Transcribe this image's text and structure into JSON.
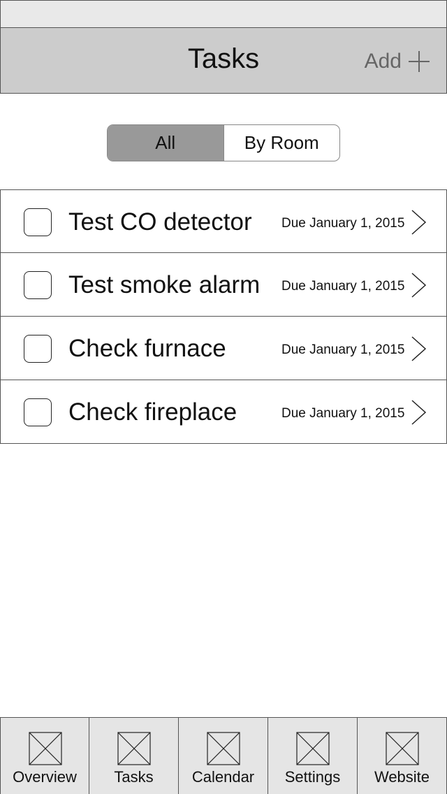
{
  "header": {
    "title": "Tasks",
    "add_label": "Add"
  },
  "filter": {
    "segments": [
      {
        "label": "All",
        "selected": true
      },
      {
        "label": "By Room",
        "selected": false
      }
    ]
  },
  "tasks": [
    {
      "title": "Test CO detector",
      "due": "Due January 1, 2015",
      "checked": false
    },
    {
      "title": "Test smoke alarm",
      "due": "Due January 1, 2015",
      "checked": false
    },
    {
      "title": "Check furnace",
      "due": "Due January 1, 2015",
      "checked": false
    },
    {
      "title": "Check fireplace",
      "due": "Due January 1, 2015",
      "checked": false
    }
  ],
  "tab_bar": {
    "tabs": [
      {
        "label": "Overview",
        "icon": "image-placeholder-icon"
      },
      {
        "label": "Tasks",
        "icon": "image-placeholder-icon"
      },
      {
        "label": "Calendar",
        "icon": "image-placeholder-icon"
      },
      {
        "label": "Settings",
        "icon": "image-placeholder-icon"
      },
      {
        "label": "Website",
        "icon": "image-placeholder-icon"
      }
    ]
  },
  "colors": {
    "nav_background": "#cccccc",
    "status_background": "#e9e9e9",
    "segment_active": "#999999",
    "tab_bar_background": "#e5e5e5",
    "add_text": "#666666"
  }
}
